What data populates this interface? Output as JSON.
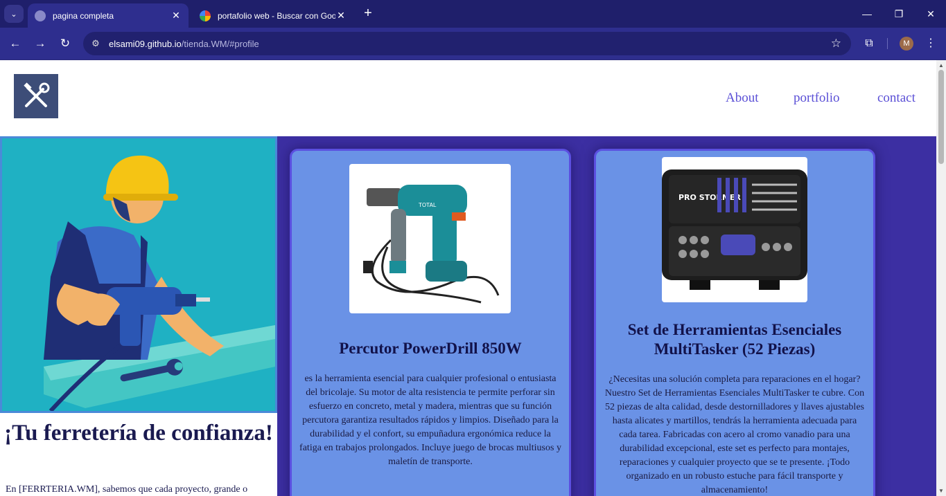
{
  "browser": {
    "tabs": [
      {
        "title": "pagina completa",
        "active": true
      },
      {
        "title": "portafolio web - Buscar con Goo",
        "active": false
      }
    ],
    "url_host": "elsami09.github.io",
    "url_path": "/tienda.WM/#profile",
    "profile_initial": "M"
  },
  "site": {
    "nav": [
      {
        "label": "About"
      },
      {
        "label": "portfolio"
      },
      {
        "label": "contact"
      }
    ],
    "hero": {
      "title": "¡Tu ferretería de confianza!",
      "text": "En [FERRTERIA.WM], sabemos que cada proyecto, grande o"
    },
    "products": [
      {
        "title": "Percutor PowerDrill 850W",
        "description": "es la herramienta esencial para cualquier profesional o entusiasta del bricolaje. Su motor de alta resistencia te permite perforar sin esfuerzo en concreto, metal y madera, mientras que su función percutora garantiza resultados rápidos y limpios. Diseñado para la durabilidad y el confort, su empuñadura ergonómica reduce la fatiga en trabajos prolongados. Incluye juego de brocas multiusos y maletín de transporte.",
        "image_text": "TOTAL"
      },
      {
        "title": "Set de Herramientas Esenciales MultiTasker (52 Piezas)",
        "description": "¿Necesitas una solución completa para reparaciones en el hogar? Nuestro Set de Herramientas Esenciales MultiTasker te cubre. Con 52 piezas de alta calidad, desde destornilladores y llaves ajustables hasta alicates y martillos, tendrás la herramienta adecuada para cada tarea. Fabricadas con acero al cromo vanadio para una durabilidad excepcional, este set es perfecto para montajes, reparaciones y cualquier proyecto que se te presente. ¡Todo organizado en un robusto estuche para fácil transporte y almacenamiento!",
        "image_text": "PRO STORMER"
      }
    ]
  }
}
